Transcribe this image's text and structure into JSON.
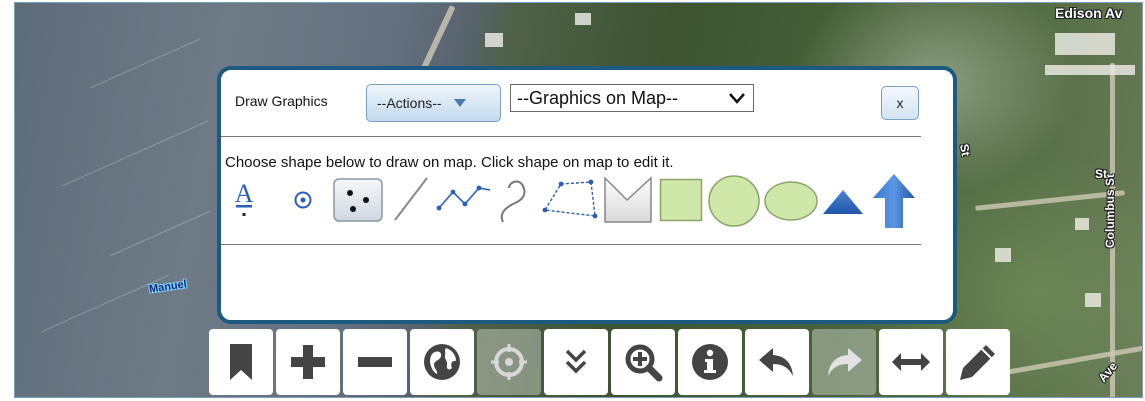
{
  "map": {
    "streets": [
      "Edison Av",
      "Columbus St",
      "Manuel",
      "St",
      "St",
      "Ave"
    ]
  },
  "dialog": {
    "title": "Draw Graphics",
    "actions_label": "--Actions--",
    "graphics_select_value": "--Graphics on Map--",
    "close_label": "x",
    "instructions": "Choose shape below to draw on map. Click shape on map to edit it.",
    "text_tool_glyph": "A",
    "tools": [
      "text-icon",
      "point-icon",
      "multipoint-icon",
      "line-icon",
      "polyline-icon",
      "freehand-line-icon",
      "polygon-icon",
      "freehand-polygon-icon",
      "rectangle-icon",
      "circle-icon",
      "ellipse-icon",
      "triangle-icon",
      "arrow-icon"
    ]
  },
  "toolbar": {
    "buttons": [
      "bookmark-icon",
      "zoom-in-icon",
      "zoom-out-icon",
      "globe-icon",
      "locate-icon",
      "double-chevron-down-icon",
      "zoom-magnifier-icon",
      "info-icon",
      "undo-icon",
      "redo-icon",
      "measure-icon",
      "pencil-icon"
    ]
  },
  "colors": {
    "dialog_border": "#1c5a7f",
    "shape_fill": "#cfe7a8",
    "shape_stroke": "#8aa56a",
    "accent_blue": "#2a5fb8",
    "icon_gray": "#444444"
  }
}
